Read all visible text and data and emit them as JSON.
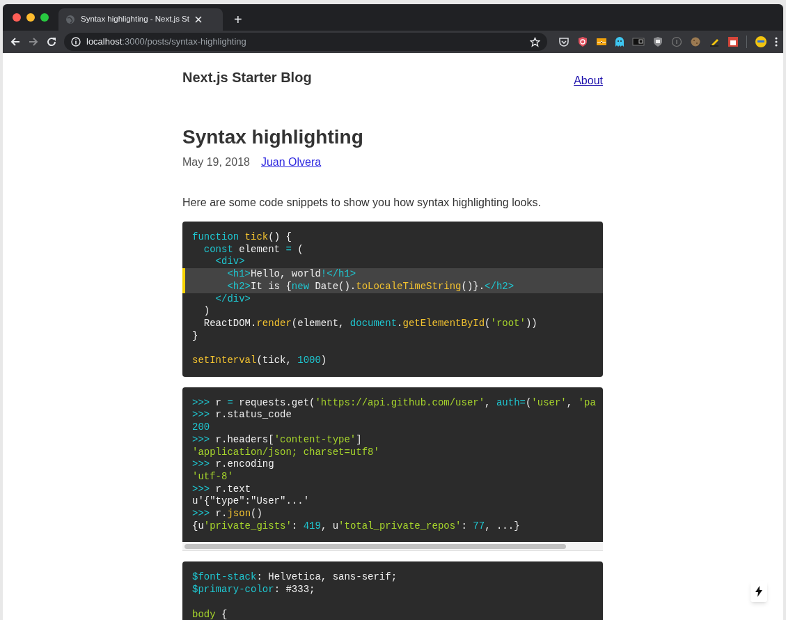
{
  "browser": {
    "tab": {
      "title": "Syntax highlighting - Next.js St",
      "selected": true
    },
    "new_tab": "+",
    "address": {
      "host": "localhost",
      "path": ":3000/posts/syntax-highlighting"
    }
  },
  "header": {
    "site_title": "Next.js Starter Blog",
    "nav_link": "About"
  },
  "post": {
    "title": "Syntax highlighting",
    "date": "May 19, 2018",
    "author": "Juan Olvera",
    "intro": "Here are some code snippets to show you how syntax highlighting looks.",
    "code_blocks": [
      {
        "scrollbar": false,
        "lines": [
          {
            "highlighted": false,
            "tokens": [
              {
                "kind": "keyword",
                "text": "function"
              },
              {
                "kind": "function",
                "text": " tick"
              },
              {
                "kind": "plain",
                "text": "() {"
              }
            ]
          },
          {
            "highlighted": false,
            "tokens": [
              {
                "kind": "keyword",
                "text": "  const"
              },
              {
                "kind": "plain",
                "text": " element "
              },
              {
                "kind": "operator",
                "text": "="
              },
              {
                "kind": "plain",
                "text": " ("
              }
            ]
          },
          {
            "highlighted": false,
            "tokens": [
              {
                "kind": "tag",
                "text": "    <div>"
              }
            ]
          },
          {
            "highlighted": true,
            "tokens": [
              {
                "kind": "tag",
                "text": "      <h1>"
              },
              {
                "kind": "plain",
                "text": "Hello, world"
              },
              {
                "kind": "operator",
                "text": "!"
              },
              {
                "kind": "tag",
                "text": "</h1>"
              }
            ]
          },
          {
            "highlighted": true,
            "tokens": [
              {
                "kind": "tag",
                "text": "      <h2>"
              },
              {
                "kind": "plain",
                "text": "It is {"
              },
              {
                "kind": "keyword",
                "text": "new"
              },
              {
                "kind": "plain",
                "text": " Date()."
              },
              {
                "kind": "function",
                "text": "toLocaleTimeString"
              },
              {
                "kind": "plain",
                "text": "()}."
              },
              {
                "kind": "tag",
                "text": "</h2>"
              }
            ]
          },
          {
            "highlighted": false,
            "tokens": [
              {
                "kind": "tag",
                "text": "    </div>"
              }
            ]
          },
          {
            "highlighted": false,
            "tokens": [
              {
                "kind": "plain",
                "text": "  )"
              }
            ]
          },
          {
            "highlighted": false,
            "tokens": [
              {
                "kind": "plain",
                "text": "  ReactDOM."
              },
              {
                "kind": "function",
                "text": "render"
              },
              {
                "kind": "plain",
                "text": "(element, "
              },
              {
                "kind": "keyword",
                "text": "document"
              },
              {
                "kind": "plain",
                "text": "."
              },
              {
                "kind": "function",
                "text": "getElementById"
              },
              {
                "kind": "plain",
                "text": "("
              },
              {
                "kind": "string",
                "text": "'root'"
              },
              {
                "kind": "plain",
                "text": "))"
              }
            ]
          },
          {
            "highlighted": false,
            "tokens": [
              {
                "kind": "plain",
                "text": "}"
              }
            ]
          },
          {
            "highlighted": false,
            "space_before": true,
            "tokens": [
              {
                "kind": "function",
                "text": "setInterval"
              },
              {
                "kind": "plain",
                "text": "(tick, "
              },
              {
                "kind": "number",
                "text": "1000"
              },
              {
                "kind": "plain",
                "text": ")"
              }
            ]
          }
        ]
      },
      {
        "scrollbar": true,
        "lines": [
          {
            "highlighted": false,
            "tokens": [
              {
                "kind": "prompt",
                "text": ">>>"
              },
              {
                "kind": "plain",
                "text": " r "
              },
              {
                "kind": "operator",
                "text": "="
              },
              {
                "kind": "plain",
                "text": " requests.get("
              },
              {
                "kind": "string",
                "text": "'https://api.github.com/user'"
              },
              {
                "kind": "plain",
                "text": ", "
              },
              {
                "kind": "keyword",
                "text": "auth"
              },
              {
                "kind": "operator",
                "text": "="
              },
              {
                "kind": "plain",
                "text": "("
              },
              {
                "kind": "string",
                "text": "'user'"
              },
              {
                "kind": "plain",
                "text": ", "
              },
              {
                "kind": "string",
                "text": "'pa"
              }
            ]
          },
          {
            "highlighted": false,
            "tokens": [
              {
                "kind": "prompt",
                "text": ">>>"
              },
              {
                "kind": "plain",
                "text": " r.status_code"
              }
            ]
          },
          {
            "highlighted": false,
            "tokens": [
              {
                "kind": "number",
                "text": "200"
              }
            ]
          },
          {
            "highlighted": false,
            "tokens": [
              {
                "kind": "prompt",
                "text": ">>>"
              },
              {
                "kind": "plain",
                "text": " r.headers["
              },
              {
                "kind": "string",
                "text": "'content-type'"
              },
              {
                "kind": "plain",
                "text": "]"
              }
            ]
          },
          {
            "highlighted": false,
            "tokens": [
              {
                "kind": "string",
                "text": "'application/json; charset=utf8'"
              }
            ]
          },
          {
            "highlighted": false,
            "tokens": [
              {
                "kind": "prompt",
                "text": ">>>"
              },
              {
                "kind": "plain",
                "text": " r.encoding"
              }
            ]
          },
          {
            "highlighted": false,
            "tokens": [
              {
                "kind": "string",
                "text": "'utf-8'"
              }
            ]
          },
          {
            "highlighted": false,
            "tokens": [
              {
                "kind": "prompt",
                "text": ">>>"
              },
              {
                "kind": "plain",
                "text": " r.text"
              }
            ]
          },
          {
            "highlighted": false,
            "tokens": [
              {
                "kind": "plain",
                "text": "u'{\"type\":\"User\"...'"
              }
            ]
          },
          {
            "highlighted": false,
            "tokens": [
              {
                "kind": "prompt",
                "text": ">>>"
              },
              {
                "kind": "plain",
                "text": " r."
              },
              {
                "kind": "function",
                "text": "json"
              },
              {
                "kind": "plain",
                "text": "()"
              }
            ]
          },
          {
            "highlighted": false,
            "tokens": [
              {
                "kind": "plain",
                "text": "{u"
              },
              {
                "kind": "string",
                "text": "'private_gists'"
              },
              {
                "kind": "plain",
                "text": ": "
              },
              {
                "kind": "number",
                "text": "419"
              },
              {
                "kind": "plain",
                "text": ", u"
              },
              {
                "kind": "string",
                "text": "'total_private_repos'"
              },
              {
                "kind": "plain",
                "text": ": "
              },
              {
                "kind": "number",
                "text": "77"
              },
              {
                "kind": "plain",
                "text": ", ...}"
              }
            ]
          }
        ]
      },
      {
        "scrollbar": false,
        "lines": [
          {
            "highlighted": false,
            "tokens": [
              {
                "kind": "variable",
                "text": "$font-stack"
              },
              {
                "kind": "plain",
                "text": ": Helvetica, sans-serif;"
              }
            ]
          },
          {
            "highlighted": false,
            "tokens": [
              {
                "kind": "variable",
                "text": "$primary-color"
              },
              {
                "kind": "plain",
                "text": ": #333;"
              }
            ]
          },
          {
            "highlighted": false,
            "space_before": true,
            "tokens": [
              {
                "kind": "selector",
                "text": "body"
              },
              {
                "kind": "plain",
                "text": " {"
              }
            ]
          }
        ]
      }
    ]
  }
}
